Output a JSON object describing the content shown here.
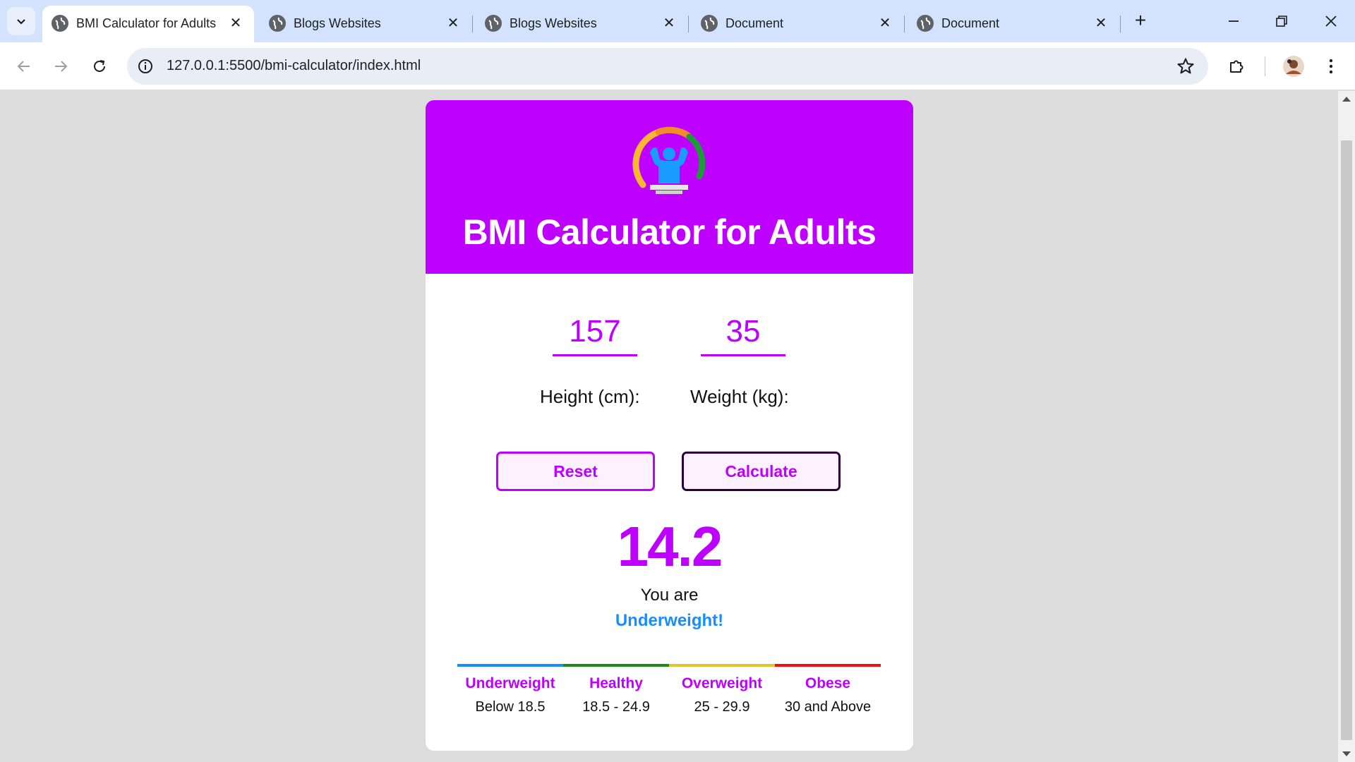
{
  "browser": {
    "tabs": [
      {
        "title": "BMI Calculator for Adults",
        "active": true
      },
      {
        "title": "Blogs Websites",
        "active": false
      },
      {
        "title": "Blogs Websites",
        "active": false
      },
      {
        "title": "Document",
        "active": false
      },
      {
        "title": "Document",
        "active": false
      }
    ],
    "url": "127.0.0.1:5500/bmi-calculator/index.html"
  },
  "app": {
    "title": "BMI Calculator for Adults",
    "height_value": "157",
    "weight_value": "35",
    "height_label": "Height (cm):",
    "weight_label": "Weight (kg):",
    "reset_label": "Reset",
    "calculate_label": "Calculate",
    "bmi_result": "14.2",
    "you_are_text": "You are",
    "status_text": "Underweight!",
    "status_color": "#1a8cff",
    "accent_color": "#bd00ff",
    "ranges": [
      {
        "name": "Underweight",
        "value": "Below 18.5",
        "color": "#1a8cff"
      },
      {
        "name": "Healthy",
        "value": "18.5 - 24.9",
        "color": "#1b8a1b"
      },
      {
        "name": "Overweight",
        "value": "25 - 29.9",
        "color": "#e0c62a"
      },
      {
        "name": "Obese",
        "value": "30 and Above",
        "color": "#ee1111"
      }
    ]
  }
}
